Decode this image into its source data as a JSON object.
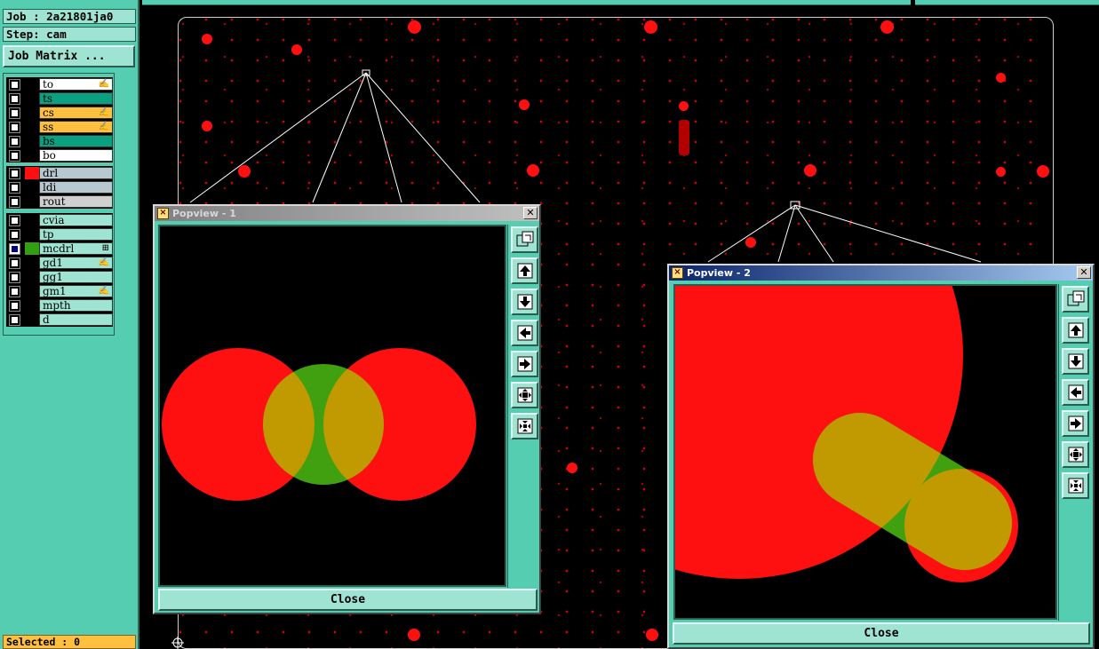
{
  "job": {
    "label": "Job : 2a21801ja0",
    "step": "Step: cam"
  },
  "job_matrix_label": "Job Matrix ...",
  "layer_groups": [
    [
      {
        "name": "to",
        "bg": "#ffffff",
        "color": "#000000",
        "mark": "✍"
      },
      {
        "name": "ts",
        "bg": "#0aa080",
        "color": "#000000",
        "mark": ""
      },
      {
        "name": "cs",
        "bg": "#ffc040",
        "color": "#000000",
        "mark": "✍"
      },
      {
        "name": "ss",
        "bg": "#ffc040",
        "color": "#000000",
        "mark": "✍"
      },
      {
        "name": "bs",
        "bg": "#0aa080",
        "color": "#000000",
        "mark": ""
      },
      {
        "name": "bo",
        "bg": "#ffffff",
        "color": "#000000",
        "mark": ""
      }
    ],
    [
      {
        "name": "drl",
        "bg": "#b8c8d0",
        "color": "#ff1010",
        "mark": ""
      },
      {
        "name": "ldi",
        "bg": "#b8c8d0",
        "color": "#000000",
        "mark": ""
      },
      {
        "name": "rout",
        "bg": "#d0d0d0",
        "color": "#000000",
        "mark": ""
      }
    ],
    [
      {
        "name": "cvia",
        "bg": "#9fe3d3",
        "color": "#000000",
        "mark": ""
      },
      {
        "name": "tp",
        "bg": "#9fe3d3",
        "color": "#000000",
        "mark": ""
      },
      {
        "name": "mcdrl",
        "bg": "#9fe3d3",
        "color": "#30a010",
        "mark": "⊞",
        "selected": true
      },
      {
        "name": "gd1",
        "bg": "#9fe3d3",
        "color": "#000000",
        "mark": "✍"
      },
      {
        "name": "gg1",
        "bg": "#9fe3d3",
        "color": "#000000",
        "mark": ""
      },
      {
        "name": "gm1",
        "bg": "#9fe3d3",
        "color": "#000000",
        "mark": "✍"
      },
      {
        "name": "mpth",
        "bg": "#9fe3d3",
        "color": "#000000",
        "mark": ""
      },
      {
        "name": "d",
        "bg": "#9fe3d3",
        "color": "#000000",
        "mark": ""
      }
    ]
  ],
  "selected_label": "Selected : 0",
  "popview1": {
    "title": "Popview - 1",
    "close_label": "Close"
  },
  "popview2": {
    "title": "Popview - 2",
    "close_label": "Close"
  },
  "toolbar_icons": [
    "zoom-fit-icon",
    "pan-up-icon",
    "pan-down-icon",
    "pan-left-icon",
    "pan-right-icon",
    "zoom-in-icon",
    "zoom-out-icon"
  ],
  "colors": {
    "pad_red": "#ff1010",
    "overlap_olive": "#c09a00",
    "drill_green": "#40a010",
    "panel_teal": "#55cdb0"
  }
}
